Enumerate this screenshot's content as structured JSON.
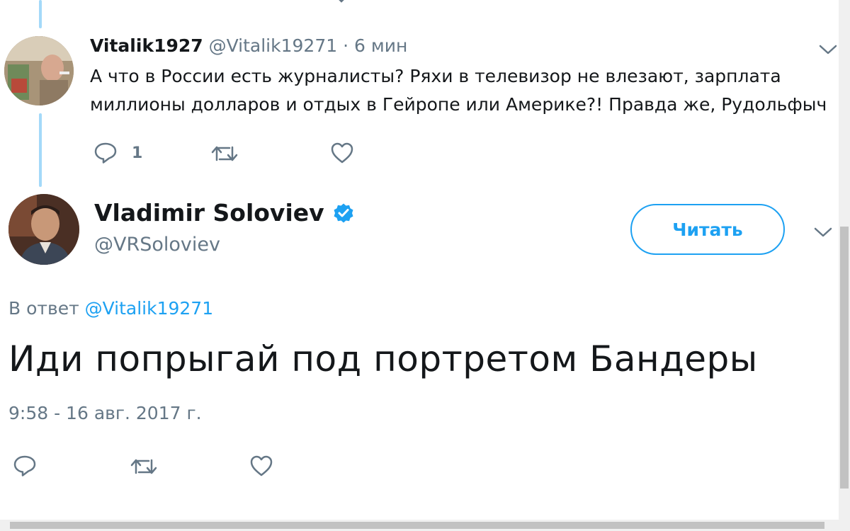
{
  "reply_tweet": {
    "display_name": "Vitalik1927",
    "handle": "@Vitalik19271",
    "separator": "·",
    "time_ago": "6 мин",
    "text": "А что в России есть журналисты? Ряхи в телевизор не влезают, зарплата миллионы долларов и отдых в Гейропе или Америке?! Правда же, Рудольфыч",
    "reply_count": "1"
  },
  "main_tweet": {
    "display_name": "Vladimir Soloviev",
    "handle": "@VRSoloviev",
    "verified": true,
    "follow_label": "Читать",
    "reply_to_prefix": "В ответ",
    "reply_to_mention": "@Vitalik19271",
    "text": "Иди попрыгай под портретом Бандеры",
    "timestamp": "9:58 - 16 авг. 2017 г."
  },
  "icons": [
    "reply-icon",
    "retweet-icon",
    "like-icon",
    "chevron-down-icon",
    "verified-badge-icon"
  ],
  "colors": {
    "accent": "#1da1f2",
    "muted": "#657786",
    "text": "#14171a",
    "thread_line": "#a4d9f9"
  }
}
